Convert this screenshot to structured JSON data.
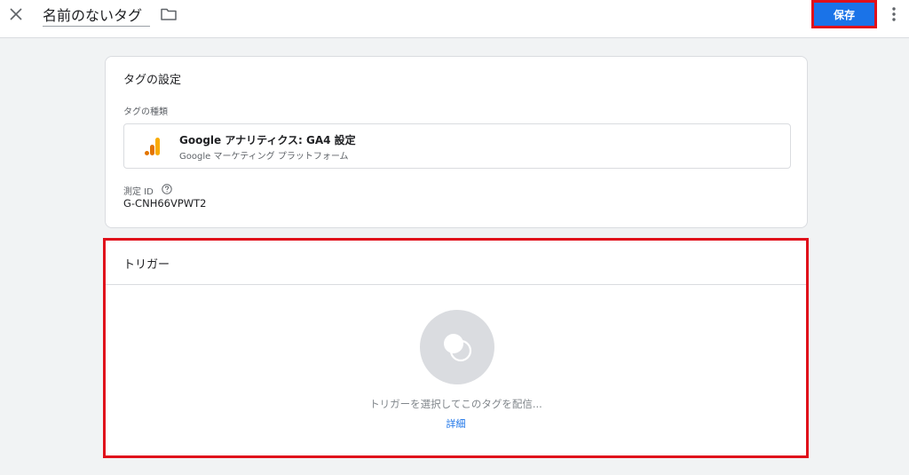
{
  "header": {
    "tag_name": "名前のないタグ",
    "save_label": "保存",
    "close_icon": "close-icon",
    "folder_icon": "folder-icon",
    "more_icon": "more-vert-icon"
  },
  "tag_settings": {
    "title": "タグの設定",
    "type_label": "タグの種類",
    "tag_type": {
      "name": "Google アナリティクス: GA4 設定",
      "subtitle": "Google マーケティング プラットフォーム",
      "icon": "google-analytics-icon"
    },
    "measurement_id_label": "測定 ID",
    "measurement_id_value": "G-CNH66VPWT2",
    "help_icon": "help-icon"
  },
  "trigger": {
    "title": "トリガー",
    "placeholder": "トリガーを選択してこのタグを配信...",
    "details_link": "詳細",
    "icon": "trigger-icon"
  },
  "colors": {
    "accent": "#1a73e8",
    "highlight": "#e0101b",
    "ga_orange": "#f9ab00",
    "ga_orange_dark": "#e37400"
  }
}
